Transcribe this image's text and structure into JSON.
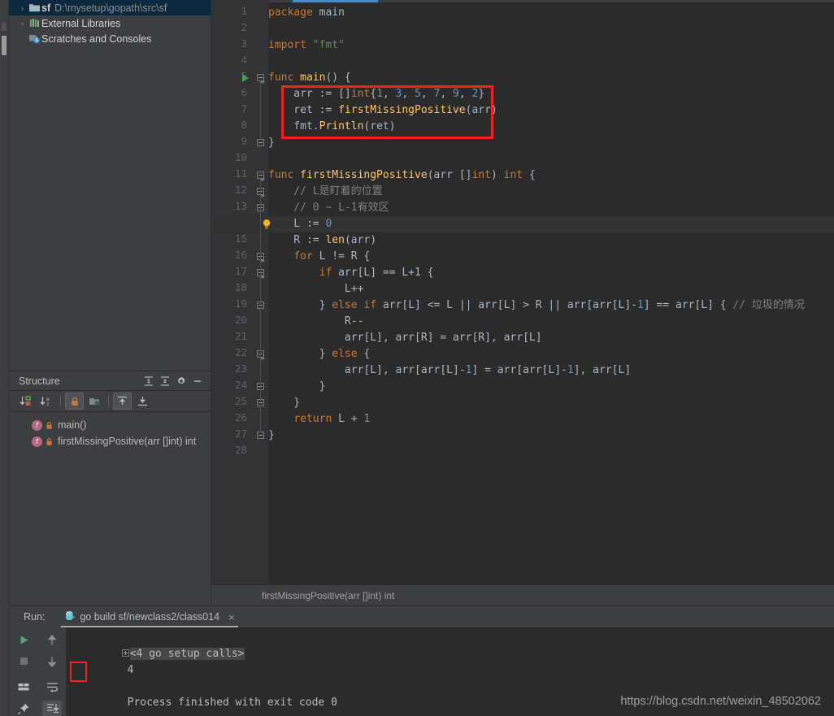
{
  "project": {
    "tree": [
      {
        "arrow": "›",
        "icon": "folder-icon",
        "name": "sf",
        "sub": "D:\\mysetup\\gopath\\src\\sf",
        "selected": true
      },
      {
        "arrow": "›",
        "icon": "library-icon",
        "name": "External Libraries",
        "sub": "",
        "selected": false
      },
      {
        "arrow": "",
        "icon": "scratches-icon",
        "name": "Scratches and Consoles",
        "sub": "",
        "selected": false
      }
    ]
  },
  "structure": {
    "title": "Structure",
    "header_buttons": [
      "expand-all-icon",
      "collapse-all-icon",
      "settings-gear-icon",
      "hide-icon"
    ],
    "toolbar_buttons": [
      "sort-by-visibility-icon",
      "sort-alphabetically-icon",
      "show-non-public-icon",
      "group-icon",
      "show-inherited-icon",
      "show-anonymous-icon"
    ],
    "items": [
      {
        "kind": "f",
        "label": "main()"
      },
      {
        "kind": "f",
        "label": "firstMissingPositive(arr []int) int"
      }
    ]
  },
  "editor": {
    "lines": [
      {
        "n": 1,
        "tokens": [
          {
            "t": "package",
            "c": "kw"
          },
          {
            "t": " main",
            "c": "txt"
          }
        ]
      },
      {
        "n": 2,
        "tokens": []
      },
      {
        "n": 3,
        "tokens": [
          {
            "t": "import",
            "c": "kw"
          },
          {
            "t": " ",
            "c": "txt"
          },
          {
            "t": "\"fmt\"",
            "c": "str"
          }
        ]
      },
      {
        "n": 4,
        "tokens": []
      },
      {
        "n": 5,
        "tokens": [
          {
            "t": "func",
            "c": "kw"
          },
          {
            "t": " ",
            "c": "txt"
          },
          {
            "t": "main",
            "c": "fn"
          },
          {
            "t": "() {",
            "c": "txt"
          }
        ]
      },
      {
        "n": 6,
        "tokens": [
          {
            "t": "    arr := []",
            "c": "txt"
          },
          {
            "t": "int",
            "c": "kw"
          },
          {
            "t": "{",
            "c": "txt"
          },
          {
            "t": "1",
            "c": "num"
          },
          {
            "t": ", ",
            "c": "txt"
          },
          {
            "t": "3",
            "c": "num"
          },
          {
            "t": ", ",
            "c": "txt"
          },
          {
            "t": "5",
            "c": "num"
          },
          {
            "t": ", ",
            "c": "txt"
          },
          {
            "t": "7",
            "c": "num"
          },
          {
            "t": ", ",
            "c": "txt"
          },
          {
            "t": "9",
            "c": "num"
          },
          {
            "t": ", ",
            "c": "txt"
          },
          {
            "t": "2",
            "c": "num"
          },
          {
            "t": "}",
            "c": "txt"
          }
        ]
      },
      {
        "n": 7,
        "tokens": [
          {
            "t": "    ret := ",
            "c": "txt"
          },
          {
            "t": "firstMissingPositive",
            "c": "fn"
          },
          {
            "t": "(arr)",
            "c": "txt"
          }
        ]
      },
      {
        "n": 8,
        "tokens": [
          {
            "t": "    fmt.",
            "c": "txt"
          },
          {
            "t": "Println",
            "c": "fn"
          },
          {
            "t": "(ret)",
            "c": "txt"
          }
        ]
      },
      {
        "n": 9,
        "tokens": [
          {
            "t": "}",
            "c": "txt"
          }
        ]
      },
      {
        "n": 10,
        "tokens": []
      },
      {
        "n": 11,
        "tokens": [
          {
            "t": "func",
            "c": "kw"
          },
          {
            "t": " ",
            "c": "txt"
          },
          {
            "t": "firstMissingPositive",
            "c": "fn"
          },
          {
            "t": "(arr []",
            "c": "txt"
          },
          {
            "t": "int",
            "c": "kw"
          },
          {
            "t": ") ",
            "c": "txt"
          },
          {
            "t": "int",
            "c": "kw"
          },
          {
            "t": " {",
            "c": "txt"
          }
        ]
      },
      {
        "n": 12,
        "tokens": [
          {
            "t": "    // L是盯着的位置",
            "c": "cmt"
          }
        ]
      },
      {
        "n": 13,
        "tokens": [
          {
            "t": "    // 0 ~ L-1有效区",
            "c": "cmt"
          }
        ]
      },
      {
        "n": 14,
        "tokens": [
          {
            "t": "    L := ",
            "c": "txt"
          },
          {
            "t": "0",
            "c": "num"
          }
        ]
      },
      {
        "n": 15,
        "tokens": [
          {
            "t": "    R := ",
            "c": "txt"
          },
          {
            "t": "len",
            "c": "fn"
          },
          {
            "t": "(arr)",
            "c": "txt"
          }
        ]
      },
      {
        "n": 16,
        "tokens": [
          {
            "t": "    ",
            "c": "txt"
          },
          {
            "t": "for",
            "c": "kw"
          },
          {
            "t": " L != R {",
            "c": "txt"
          }
        ]
      },
      {
        "n": 17,
        "tokens": [
          {
            "t": "        ",
            "c": "txt"
          },
          {
            "t": "if",
            "c": "kw"
          },
          {
            "t": " arr[L] == L+1 {",
            "c": "txt"
          }
        ]
      },
      {
        "n": 18,
        "tokens": [
          {
            "t": "            L++",
            "c": "txt"
          }
        ]
      },
      {
        "n": 19,
        "tokens": [
          {
            "t": "        } ",
            "c": "txt"
          },
          {
            "t": "else if",
            "c": "kw"
          },
          {
            "t": " arr[L] <= L || arr[L] > R || arr[arr[L]-",
            "c": "txt"
          },
          {
            "t": "1",
            "c": "num"
          },
          {
            "t": "] == arr[L] { ",
            "c": "txt"
          },
          {
            "t": "// 垃圾的情况",
            "c": "cmt"
          }
        ]
      },
      {
        "n": 20,
        "tokens": [
          {
            "t": "            R--",
            "c": "txt"
          }
        ]
      },
      {
        "n": 21,
        "tokens": [
          {
            "t": "            arr[L], arr[R] = arr[R], arr[L]",
            "c": "txt"
          }
        ]
      },
      {
        "n": 22,
        "tokens": [
          {
            "t": "        } ",
            "c": "txt"
          },
          {
            "t": "else",
            "c": "kw"
          },
          {
            "t": " {",
            "c": "txt"
          }
        ]
      },
      {
        "n": 23,
        "tokens": [
          {
            "t": "            arr[L], arr[arr[L]-",
            "c": "txt"
          },
          {
            "t": "1",
            "c": "num"
          },
          {
            "t": "] = arr[arr[L]-",
            "c": "txt"
          },
          {
            "t": "1",
            "c": "num"
          },
          {
            "t": "], arr[L]",
            "c": "txt"
          }
        ]
      },
      {
        "n": 24,
        "tokens": [
          {
            "t": "        }",
            "c": "txt"
          }
        ]
      },
      {
        "n": 25,
        "tokens": [
          {
            "t": "    }",
            "c": "txt"
          }
        ]
      },
      {
        "n": 26,
        "tokens": [
          {
            "t": "    ",
            "c": "txt"
          },
          {
            "t": "return",
            "c": "kw"
          },
          {
            "t": " L + ",
            "c": "txt"
          },
          {
            "t": "1",
            "c": "num"
          }
        ]
      },
      {
        "n": 27,
        "tokens": [
          {
            "t": "}",
            "c": "txt"
          }
        ]
      },
      {
        "n": 28,
        "tokens": []
      }
    ],
    "current_line": 14,
    "gutter_run_marker_line": 5,
    "bulb_line": 14,
    "highlight_box": {
      "from_line": 6,
      "to_line": 8,
      "color": "#f81f1f"
    }
  },
  "breadcrumb": {
    "text": "firstMissingPositive(arr []int) int"
  },
  "run": {
    "label": "Run:",
    "tab_title": "go build sf/newclass2/class014",
    "tab_close": "×",
    "left_buttons": [
      "run-icon",
      "stop-icon",
      "layout-icon",
      "pin-icon"
    ],
    "mid_buttons": [
      "up-arrow-icon",
      "down-arrow-icon",
      "soft-wrap-icon",
      "scroll-to-end-icon"
    ],
    "console": {
      "setup_calls": "<4 go setup calls>",
      "output": "4",
      "exit_message": "Process finished with exit code 0"
    }
  },
  "watermark": {
    "text": "https://blog.csdn.net/weixin_48502062"
  },
  "colors": {
    "accent": "#4a88c7",
    "selection": "#0d293e",
    "editor_bg": "#2b2b2b",
    "panel_bg": "#3c3f41",
    "gutter_bg": "#313335",
    "highlight_red": "#f81f1f"
  }
}
